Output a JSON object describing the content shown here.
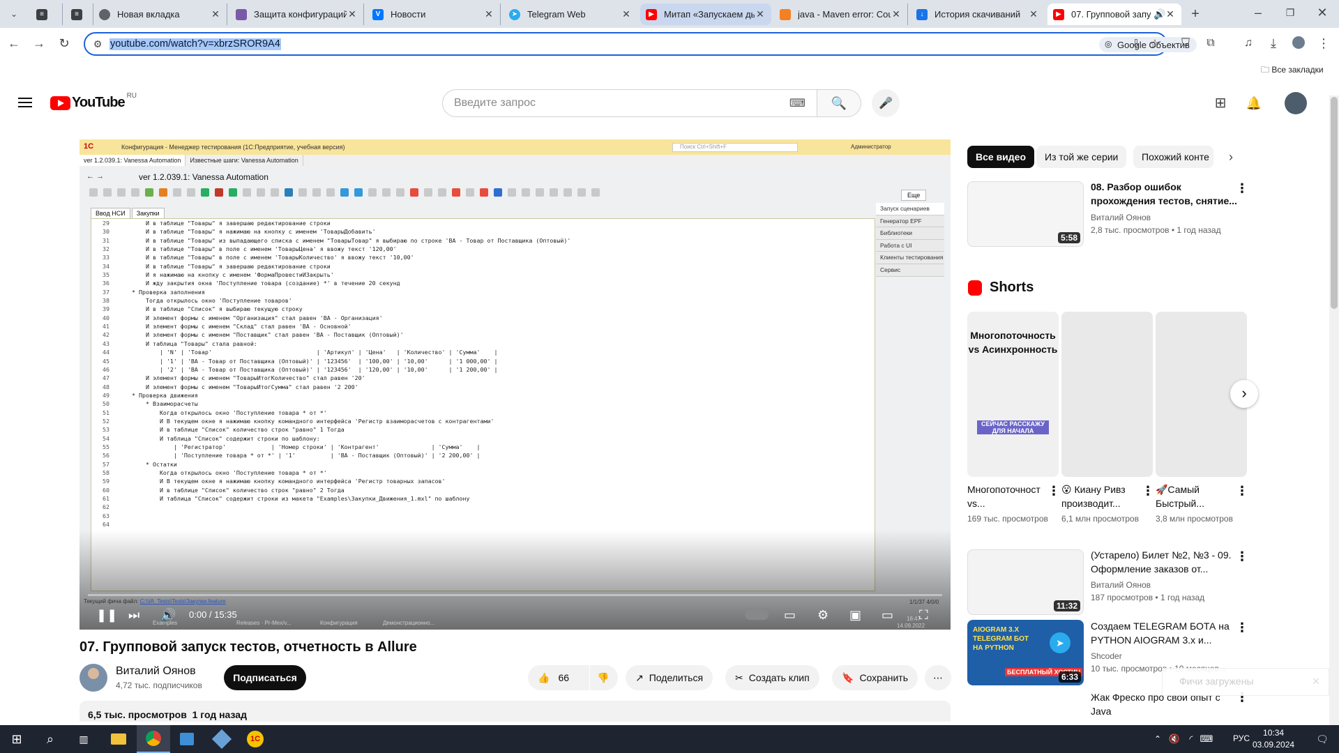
{
  "browser": {
    "tabs": [
      {
        "title": "Новая вкладка",
        "icon": "chrome-icon",
        "color": "#5f6368"
      },
      {
        "title": "Защита конфигураций",
        "icon": "doc-icon",
        "color": "#7a5aa8"
      },
      {
        "title": "Новости",
        "icon": "vk-icon",
        "color": "#0077ff"
      },
      {
        "title": "Telegram Web",
        "icon": "telegram-icon",
        "color": "#2aabee"
      },
      {
        "title": "Митап «Запускаем ды",
        "icon": "youtube-icon",
        "color": "#ff0000"
      },
      {
        "title": "java - Maven error: Cou",
        "icon": "stackoverflow-icon",
        "color": "#f48024"
      },
      {
        "title": "История скачиваний",
        "icon": "download-icon",
        "color": "#1a73e8"
      },
      {
        "title": "07. Групповой запу",
        "icon": "youtube-icon",
        "color": "#ff0000"
      }
    ],
    "url": "youtube.com/watch?v=xbrzSROR9A4",
    "lens_label": "Google Объектив",
    "bookmarks_label": "Все закладки"
  },
  "youtube": {
    "logo": "YouTube",
    "region": "RU",
    "search_placeholder": "Введите запрос"
  },
  "video": {
    "window_title": "Конфигурация - Менеджер тестирования (1С:Предприятие, учебная версия)",
    "search_hint": "Поиск Ctrl+Shift+F",
    "user": "Администратор",
    "tabs": [
      "ver 1.2.039.1: Vanessa Automation",
      "Известные шаги: Vanessa Automation"
    ],
    "heading": "ver 1.2.039.1: Vanessa Automation",
    "more_label": "Еще",
    "editor_tabs": [
      "Ввод НСИ",
      "Закупки"
    ],
    "side_items": [
      "Запуск сценариев",
      "Генератор EPF",
      "Библиотеки",
      "Работа с UI",
      "Клиенты тестирования",
      "Сервис"
    ],
    "code_lines": [
      {
        "n": "29",
        "t": "        И в таблице \"Товары\" я завершаю редактирование строки"
      },
      {
        "n": "30",
        "t": "        И в таблице \"Товары\" я нажимаю на кнопку с именем 'ТоварыДобавить'"
      },
      {
        "n": "31",
        "t": "        И в таблице \"Товары\" из выпадающего списка с именем \"ТоварыТовар\" я выбираю по строке 'ВА - Товар от Поставщика (Оптовый)'"
      },
      {
        "n": "32",
        "t": "        И в таблице \"Товары\" в поле с именем 'ТоварыЦена' я ввожу текст '120,00'"
      },
      {
        "n": "33",
        "t": "        И в таблице \"Товары\" в поле с именем 'ТоварыКоличество' я ввожу текст '10,00'"
      },
      {
        "n": "34",
        "t": "        И в таблице \"Товары\" я завершаю редактирование строки"
      },
      {
        "n": "35",
        "t": "        И я нажимаю на кнопку с именем 'ФормаПровестиИЗакрыть'"
      },
      {
        "n": "36",
        "t": "        И жду закрытия окна 'Поступление товара (создание) *' в течение 20 секунд"
      },
      {
        "n": "37",
        "t": "    * Проверка заполнения"
      },
      {
        "n": "38",
        "t": "        Тогда открылось окно 'Поступление товаров'"
      },
      {
        "n": "39",
        "t": "        И в таблице \"Список\" я выбираю текущую строку"
      },
      {
        "n": "40",
        "t": "        И элемент формы с именем \"Организация\" стал равен 'ВА - Организация'"
      },
      {
        "n": "41",
        "t": "        И элемент формы с именем \"Склад\" стал равен 'ВА - Основной'"
      },
      {
        "n": "42",
        "t": "        И элемент формы с именем \"Поставщик\" стал равен 'ВА - Поставщик (Оптовый)'"
      },
      {
        "n": "43",
        "t": "        И таблица \"Товары\" стала равной:"
      },
      {
        "n": "44",
        "t": "            | 'N' | 'Товар'                              | 'Артикул' | 'Цена'   | 'Количество' | 'Сумма'    |"
      },
      {
        "n": "45",
        "t": "            | '1' | 'ВА - Товар от Поставщика (Оптовый)' | '123456'  | '100,00' | '10,00'      | '1 000,00' |"
      },
      {
        "n": "46",
        "t": "            | '2' | 'ВА - Товар от Поставщика (Оптовый)' | '123456'  | '120,00' | '10,00'      | '1 200,00' |"
      },
      {
        "n": "47",
        "t": "        И элемент формы с именем \"ТоварыИтогКоличество\" стал равен '20'"
      },
      {
        "n": "48",
        "t": "        И элемент формы с именем \"ТоварыИтогСумма\" стал равен '2 200'"
      },
      {
        "n": "49",
        "t": "    * Проверка движения"
      },
      {
        "n": "50",
        "t": "        * Взаиморасчеты"
      },
      {
        "n": "51",
        "t": "            Когда открылось окно 'Поступление товара * от *'"
      },
      {
        "n": "52",
        "t": "            И В текущем окне я нажимаю кнопку командного интерфейса 'Регистр взаиморасчетов с контрагентами'"
      },
      {
        "n": "53",
        "t": "            И в таблице \"Список\" количество строк \"равно\" 1 Тогда"
      },
      {
        "n": "54",
        "t": "            И таблица \"Список\" содержит строки по шаблону:"
      },
      {
        "n": "55",
        "t": "                | 'Регистратор'             | 'Номер строки' | 'Контрагент'               | 'Сумма'    |"
      },
      {
        "n": "56",
        "t": "                | 'Поступление товара * от *' | '1'          | 'ВА - Поставщик (Оптовый)' | '2 200,00' |"
      },
      {
        "n": "57",
        "t": "        * Остатки"
      },
      {
        "n": "58",
        "t": "            Когда открылось окно 'Поступление товара * от *'"
      },
      {
        "n": "59",
        "t": "            И В текущем окне я нажимаю кнопку командного интерфейса 'Регистр товарных запасов'"
      },
      {
        "n": "60",
        "t": "            И в таблице \"Список\" количество строк \"равно\" 2 Тогда"
      },
      {
        "n": "61",
        "t": "            И таблица \"Список\" содержит строки из макета \"Examples\\Закупки_Движения_1.mxl\" по шаблону"
      },
      {
        "n": "62",
        "t": ""
      },
      {
        "n": "63",
        "t": ""
      },
      {
        "n": "64",
        "t": ""
      }
    ],
    "status_label": "Текущий фича файл:",
    "status_path": "C:\\VA_Tests\\Tests\\Закупки.feature",
    "position": "1/1/37 4/0/0",
    "taskbar_items": [
      "Examples",
      "Releases · Pr-Mex/v...",
      "Конфигурация",
      "Демонстрационно..."
    ],
    "inner_clock": "16:47",
    "inner_date": "14.09.2022",
    "time": "0:00 / 15:35",
    "progress": 0
  },
  "details": {
    "title": "07. Групповой запуск тестов, отчетность в Allure",
    "channel": "Виталий Оянов",
    "subscribers": "4,72 тыс. подписчиков",
    "subscribe_label": "Подписаться",
    "likes": "66",
    "share_label": "Поделиться",
    "clip_label": "Создать клип",
    "save_label": "Сохранить",
    "views": "6,5 тыс. просмотров",
    "age": "1 год назад"
  },
  "sidebar": {
    "chips": [
      "Все видео",
      "Из той же серии",
      "Похожий конте"
    ],
    "shorts_title": "Shorts",
    "videos": [
      {
        "title": "08. Разбор ошибок прохождения тестов, снятие...",
        "channel": "Виталий Оянов",
        "meta": "2,8 тыс. просмотров  • 1 год назад",
        "duration": "5:58"
      },
      {
        "title": "(Устарело) Билет №2, №3 - 09. Оформление заказов от...",
        "channel": "Виталий Оянов",
        "meta": "187 просмотров  • 1 год назад",
        "duration": "11:32"
      },
      {
        "title": "Создаем TELEGRAM БОТА на PYTHON AIOGRAM 3.x и...",
        "channel": "Shcoder",
        "meta": "10 тыс. просмотров  • 10 месяцев...",
        "duration": "6:33"
      },
      {
        "title": "Жак Фреско про свой опыт с Java",
        "channel": "",
        "meta": "",
        "duration": ""
      }
    ],
    "shorts": [
      {
        "thumb_text": "Многопоточность vs Асинхронность",
        "badge": "СЕЙЧАС РАССКАЖУ ДЛЯ НАЧАЛА",
        "title": "Многопоточност vs...",
        "views": "169 тыс. просмотров"
      },
      {
        "thumb_text": "",
        "badge": "",
        "title": "😮 Киану Ривз производит...",
        "views": "6,1 млн просмотров"
      },
      {
        "thumb_text": "",
        "badge": "",
        "title": "🚀Самый Быстрый...",
        "views": "3,8 млн просмотров"
      }
    ],
    "aiogram_thumb": "AIOGRAM 3.X TELEGRAM БОТ НА PYTHON",
    "aiogram_sub": "БЕСПЛАТНЫЙ ХОСТИН",
    "toast": "Фичи загружены"
  },
  "system": {
    "lang": "РУС",
    "time": "10:34",
    "date": "03.09.2024"
  },
  "colors": {
    "accent": "#1a62d8",
    "youtube_red": "#ff0000",
    "tabstrip": "#dee3ea",
    "taskbar": "#1e2430"
  }
}
